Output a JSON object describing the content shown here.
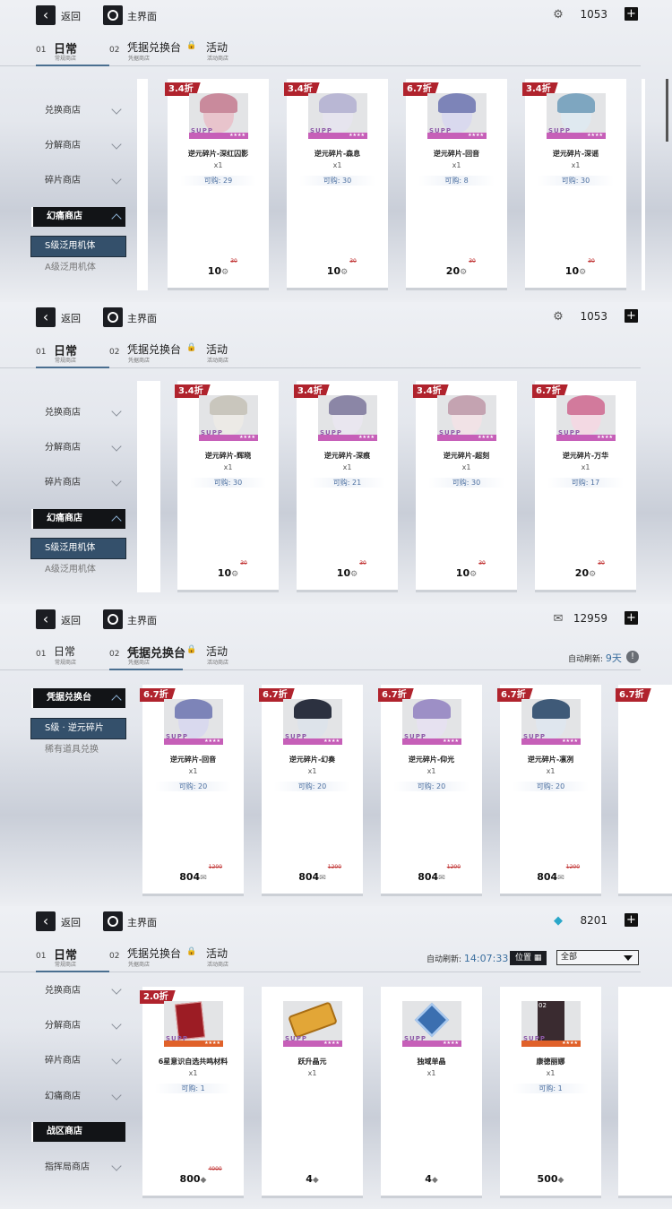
{
  "nav": {
    "back": "返回",
    "home": "主界面"
  },
  "tabs": {
    "daily": {
      "num": "01",
      "label": "日常",
      "sub": "常规商店"
    },
    "voucher": {
      "num": "02",
      "label": "凭据兑换台",
      "sub": "凭据商店"
    },
    "event": {
      "label": "活动",
      "sub": "活动商店"
    }
  },
  "side": {
    "exchange": "兑换商店",
    "decompose": "分解商店",
    "shard": "碎片商店",
    "phantom": "幻痛商店",
    "s_mech": "S级泛用机体",
    "a_mech": "A级泛用机体",
    "voucher_hub": "凭据兑换台",
    "s_shard": "S级 · 逆元碎片",
    "rare": "稀有道具兑换",
    "war": "战区商店",
    "command": "指挥局商店"
  },
  "panels": [
    {
      "currency": "1053",
      "cards": [
        {
          "discount": "3.4折",
          "name": "逆元碎片-深红囚影",
          "qty": "x1",
          "limit": "可购: 29",
          "price": "10",
          "old": "30",
          "color": "#e8c4cc",
          "hair": "#c98a9c"
        },
        {
          "discount": "3.4折",
          "name": "逆元碎片-森息",
          "qty": "x1",
          "limit": "可购: 30",
          "price": "10",
          "old": "30",
          "color": "#e6e4ee",
          "hair": "#b9b7d4"
        },
        {
          "discount": "6.7折",
          "name": "逆元碎片-回音",
          "qty": "x1",
          "limit": "可购: 8",
          "price": "20",
          "old": "30",
          "color": "#d9d9ee",
          "hair": "#7d84b8"
        },
        {
          "discount": "3.4折",
          "name": "逆元碎片-深谣",
          "qty": "x1",
          "limit": "可购: 30",
          "price": "10",
          "old": "30",
          "color": "#dfe9f0",
          "hair": "#7ea6c0"
        }
      ]
    },
    {
      "currency": "1053",
      "cards": [
        {
          "discount": "3.4折",
          "name": "逆元碎片-辉晓",
          "qty": "x1",
          "limit": "可购: 30",
          "price": "10",
          "old": "30",
          "color": "#eceae6",
          "hair": "#c9c6bd"
        },
        {
          "discount": "3.4折",
          "name": "逆元碎片-深痕",
          "qty": "x1",
          "limit": "可购: 21",
          "price": "10",
          "old": "30",
          "color": "#e9e6ef",
          "hair": "#8b86a6"
        },
        {
          "discount": "3.4折",
          "name": "逆元碎片-超刻",
          "qty": "x1",
          "limit": "可购: 30",
          "price": "10",
          "old": "30",
          "color": "#f1e2e6",
          "hair": "#c4a3b1"
        },
        {
          "discount": "6.7折",
          "name": "逆元碎片-万华",
          "qty": "x1",
          "limit": "可购: 17",
          "price": "20",
          "old": "30",
          "color": "#f3d9e3",
          "hair": "#d27a9c"
        }
      ]
    },
    {
      "currency": "12959",
      "refresh_label": "自动刷新:",
      "refresh_value": "9天",
      "cards": [
        {
          "discount": "6.7折",
          "name": "逆元碎片-回音",
          "qty": "x1",
          "limit": "可购: 20",
          "price": "804",
          "old": "1200",
          "color": "#d9d9ee",
          "hair": "#7d84b8"
        },
        {
          "discount": "6.7折",
          "name": "逆元碎片-幻奏",
          "qty": "x1",
          "limit": "可购: 20",
          "price": "804",
          "old": "1200",
          "color": "#dde3ea",
          "hair": "#2c3140"
        },
        {
          "discount": "6.7折",
          "name": "逆元碎片-仰光",
          "qty": "x1",
          "limit": "可购: 20",
          "price": "804",
          "old": "1200",
          "color": "#e6e1f0",
          "hair": "#9d8fc6"
        },
        {
          "discount": "6.7折",
          "name": "逆元碎片-凛冽",
          "qty": "x1",
          "limit": "可购: 20",
          "price": "804",
          "old": "1200",
          "color": "#dfe6ee",
          "hair": "#3f5a78"
        }
      ],
      "partial_discount": "6.7折"
    },
    {
      "currency": "8201",
      "refresh_label": "自动刷新:",
      "refresh_value": "14:07:33",
      "position": "位置",
      "filter": "全部",
      "cards": [
        {
          "discount": "2.0折",
          "name": "6星意识自选共鸣材料",
          "qty": "x1",
          "limit": "可购: 1",
          "price": "800",
          "old": "4000",
          "kind": "book"
        },
        {
          "discount": "",
          "name": "跃升晶元",
          "qty": "x1",
          "limit": "",
          "price": "4",
          "old": "",
          "kind": "chip"
        },
        {
          "discount": "",
          "name": "独域单晶",
          "qty": "x1",
          "limit": "",
          "price": "4",
          "old": "",
          "kind": "cube"
        },
        {
          "discount": "",
          "name": "康德丽娜",
          "qty": "x1",
          "limit": "可购: 1",
          "price": "500",
          "old": "",
          "kind": "char",
          "tag": "02"
        }
      ]
    }
  ],
  "colors": {
    "discount": "#b0232d",
    "accent": "#4a6f90",
    "badge": "#c65fb8"
  }
}
